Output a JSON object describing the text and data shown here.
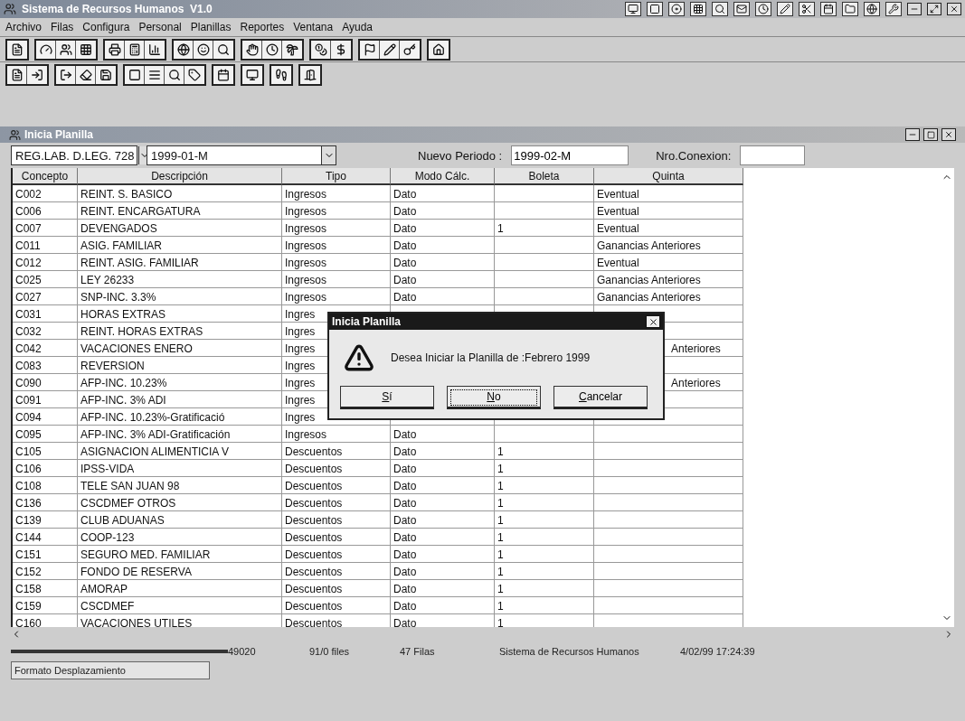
{
  "window": {
    "title": "Sistema de Recursos Humanos  V1.0"
  },
  "menu": [
    "Archivo",
    "Filas",
    "Configura",
    "Personal",
    "Planillas",
    "Reportes",
    "Ventana",
    "Ayuda"
  ],
  "child_window": {
    "title": "Inicia Planilla"
  },
  "filters": {
    "regimen": "REG.LAB. D.LEG. 728",
    "periodo": "1999-01-M",
    "nuevo_periodo_label": "Nuevo Periodo :",
    "nuevo_periodo": "1999-02-M",
    "conexion_label": "Nro.Conexion:"
  },
  "table": {
    "columns": [
      "Concepto",
      "Descripción",
      "Tipo",
      "Modo Cálc.",
      "Boleta",
      "Quinta"
    ],
    "rows": [
      {
        "cells": [
          "C002",
          "REINT. S. BASICO",
          "Ingresos",
          "Dato",
          "",
          "Eventual"
        ]
      },
      {
        "cells": [
          "C006",
          "REINT. ENCARGATURA",
          "Ingresos",
          "Dato",
          "",
          "Eventual"
        ]
      },
      {
        "cells": [
          "C007",
          "DEVENGADOS",
          "Ingresos",
          "Dato",
          "1",
          "Eventual"
        ]
      },
      {
        "cells": [
          "C011",
          "ASIG. FAMILIAR",
          "Ingresos",
          "Dato",
          "",
          "Ganancias Anteriores"
        ]
      },
      {
        "cells": [
          "C012",
          "REINT. ASIG. FAMILIAR",
          "Ingresos",
          "Dato",
          "",
          "Eventual"
        ]
      },
      {
        "cells": [
          "C025",
          "LEY 26233",
          "Ingresos",
          "Dato",
          "",
          "Ganancias Anteriores"
        ]
      },
      {
        "cells": [
          "C027",
          "SNP-INC. 3.3%",
          "Ingresos",
          "Dato",
          "",
          "Ganancias Anteriores"
        ]
      },
      {
        "cells": [
          "C031",
          "HORAS EXTRAS",
          "Ingres",
          "",
          "",
          ""
        ]
      },
      {
        "cells": [
          "C032",
          "REINT. HORAS EXTRAS",
          "Ingres",
          "",
          "",
          ""
        ]
      },
      {
        "cells": [
          "C042",
          "VACACIONES ENERO",
          "Ingres",
          "",
          "",
          "Anteriores"
        ],
        "quinta_partly_hidden": true
      },
      {
        "cells": [
          "C083",
          "REVERSION",
          "Ingres",
          "",
          "",
          ""
        ]
      },
      {
        "cells": [
          "C090",
          "AFP-INC. 10.23%",
          "Ingres",
          "",
          "",
          "Anteriores"
        ],
        "quinta_partly_hidden": true
      },
      {
        "cells": [
          "C091",
          "AFP-INC. 3% ADI",
          "Ingres",
          "",
          "",
          ""
        ]
      },
      {
        "cells": [
          "C094",
          "AFP-INC. 10.23%-Gratificació",
          "Ingres",
          "",
          "",
          ""
        ]
      },
      {
        "cells": [
          "C095",
          "AFP-INC. 3% ADI-Gratificación",
          "Ingresos",
          "Dato",
          "",
          ""
        ]
      },
      {
        "cells": [
          "C105",
          "ASIGNACION ALIMENTICIA V",
          "Descuentos",
          "Dato",
          "1",
          ""
        ]
      },
      {
        "cells": [
          "C106",
          "IPSS-VIDA",
          "Descuentos",
          "Dato",
          "1",
          ""
        ]
      },
      {
        "cells": [
          "C108",
          "TELE SAN JUAN 98",
          "Descuentos",
          "Dato",
          "1",
          ""
        ]
      },
      {
        "cells": [
          "C136",
          "CSCDMEF OTROS",
          "Descuentos",
          "Dato",
          "1",
          ""
        ]
      },
      {
        "cells": [
          "C139",
          "CLUB ADUANAS",
          "Descuentos",
          "Dato",
          "1",
          ""
        ]
      },
      {
        "cells": [
          "C144",
          "COOP-123",
          "Descuentos",
          "Dato",
          "1",
          ""
        ]
      },
      {
        "cells": [
          "C151",
          "SEGURO MED. FAMILIAR",
          "Descuentos",
          "Dato",
          "1",
          ""
        ]
      },
      {
        "cells": [
          "C152",
          "FONDO DE RESERVA",
          "Descuentos",
          "Dato",
          "1",
          ""
        ]
      },
      {
        "cells": [
          "C158",
          "AMORAP",
          "Descuentos",
          "Dato",
          "1",
          ""
        ]
      },
      {
        "cells": [
          "C159",
          "CSCDMEF",
          "Descuentos",
          "Dato",
          "1",
          ""
        ]
      },
      {
        "cells": [
          "C160",
          "VACACIONES UTILES",
          "Descuentos",
          "Dato",
          "1",
          ""
        ]
      }
    ]
  },
  "dialog": {
    "title": "Inicia Planilla",
    "message": "Desea Iniciar la Planilla de :Febrero 1999",
    "buttons": [
      {
        "label": "Sí",
        "focused": false
      },
      {
        "label": "No",
        "focused": true
      },
      {
        "label": "Cancelar",
        "focused": false
      }
    ]
  },
  "status_bar": {
    "hint": "Formato Desplazamiento",
    "fields": [
      "49020",
      "91/0 files",
      "47 Filas",
      "Sistema de Recursos Humanos",
      "4/02/99 17:24:39"
    ]
  }
}
